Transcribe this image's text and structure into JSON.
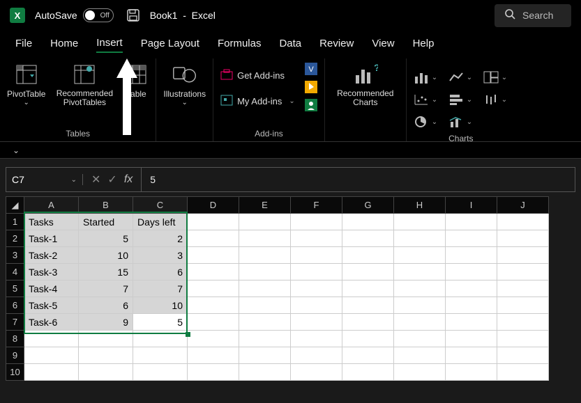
{
  "titlebar": {
    "autosave_label": "AutoSave",
    "autosave_state": "Off",
    "doc_name": "Book1",
    "app_name": "Excel",
    "search_placeholder": "Search"
  },
  "tabs": [
    "File",
    "Home",
    "Insert",
    "Page Layout",
    "Formulas",
    "Data",
    "Review",
    "View",
    "Help"
  ],
  "active_tab": "Insert",
  "ribbon": {
    "tables": {
      "label": "Tables",
      "pivot": "PivotTable",
      "rec_pivot": "Recommended PivotTables",
      "table": "Table"
    },
    "illustrations": {
      "label": "Illustrations"
    },
    "addins": {
      "label": "Add-ins",
      "get": "Get Add-ins",
      "my": "My Add-ins"
    },
    "charts": {
      "label": "Charts",
      "rec": "Recommended Charts"
    }
  },
  "namebox": "C7",
  "formula_value": "5",
  "columns": [
    "A",
    "B",
    "C",
    "D",
    "E",
    "F",
    "G",
    "H",
    "I",
    "J"
  ],
  "rows": [
    1,
    2,
    3,
    4,
    5,
    6,
    7,
    8,
    9,
    10
  ],
  "sheet": {
    "headers": [
      "Tasks",
      "Started",
      "Days left"
    ],
    "data": [
      {
        "task": "Task-1",
        "started": 5,
        "days": 2
      },
      {
        "task": "Task-2",
        "started": 10,
        "days": 3
      },
      {
        "task": "Task-3",
        "started": 15,
        "days": 6
      },
      {
        "task": "Task-4",
        "started": 7,
        "days": 7
      },
      {
        "task": "Task-5",
        "started": 6,
        "days": 10
      },
      {
        "task": "Task-6",
        "started": 9,
        "days": 5
      }
    ]
  },
  "chart_data": {
    "type": "table",
    "title": "",
    "columns": [
      "Tasks",
      "Started",
      "Days left"
    ],
    "rows": [
      [
        "Task-1",
        5,
        2
      ],
      [
        "Task-2",
        10,
        3
      ],
      [
        "Task-3",
        15,
        6
      ],
      [
        "Task-4",
        7,
        7
      ],
      [
        "Task-5",
        6,
        10
      ],
      [
        "Task-6",
        9,
        5
      ]
    ]
  }
}
